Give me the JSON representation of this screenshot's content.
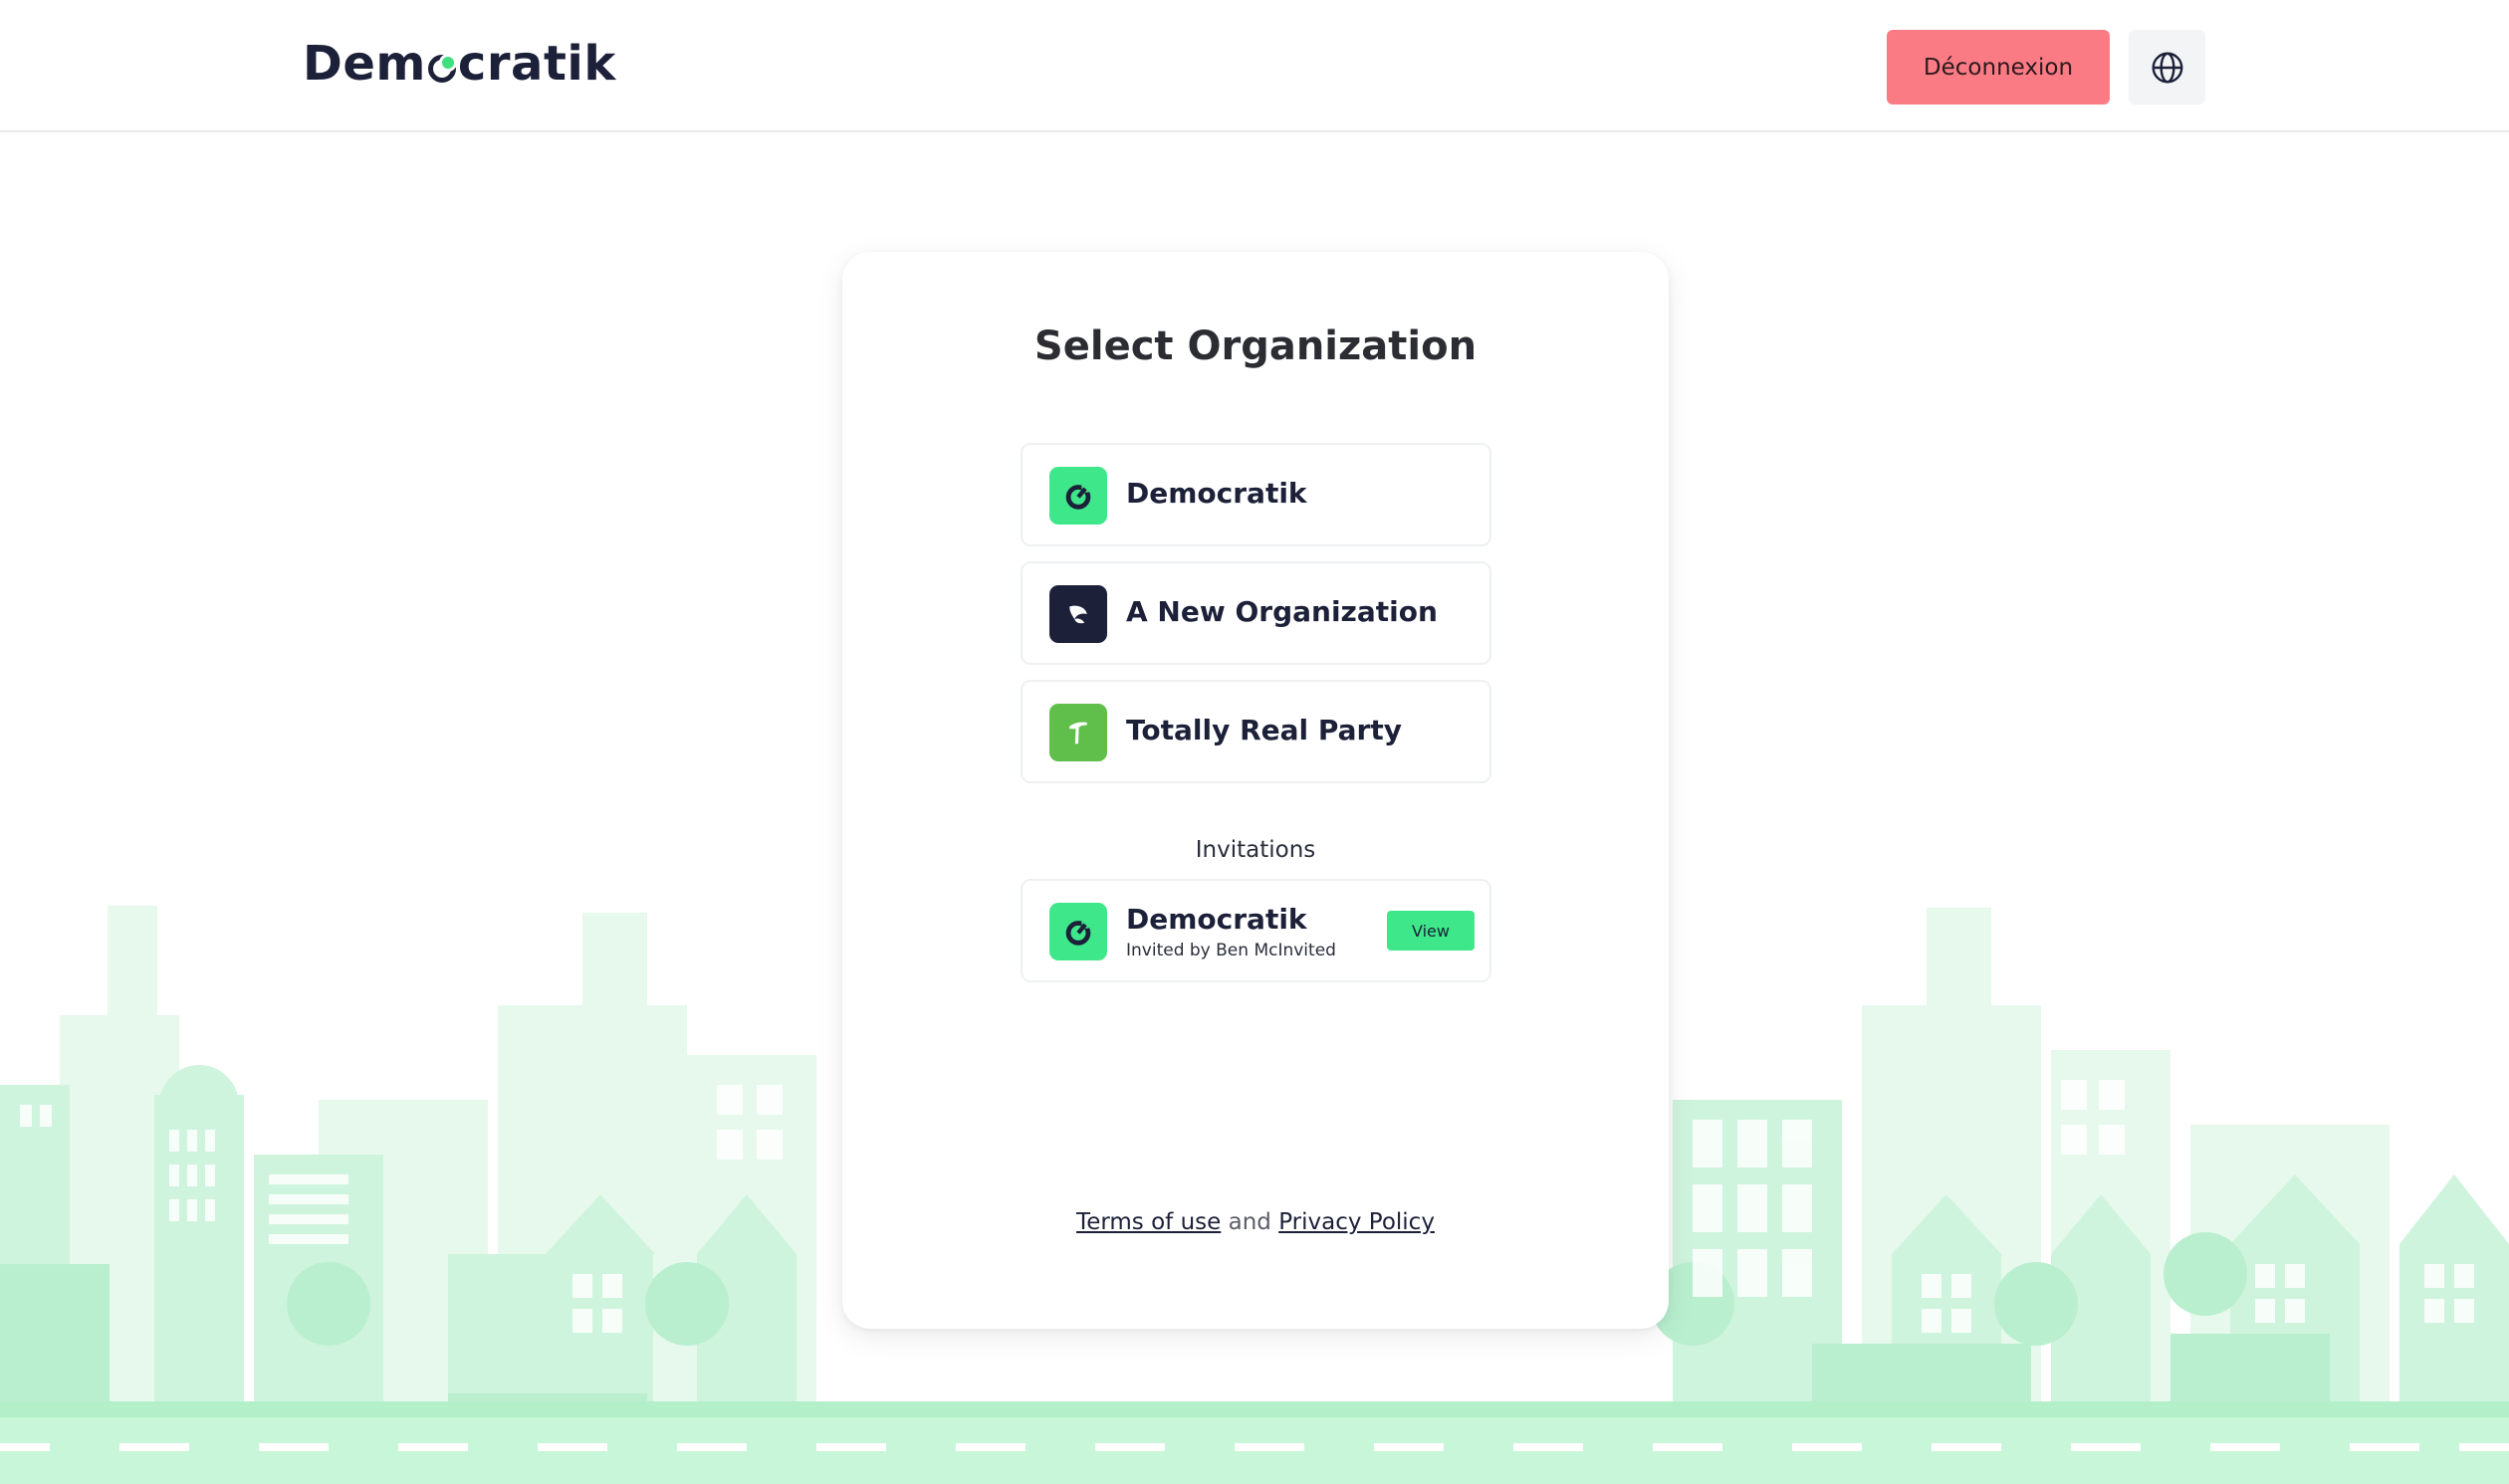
{
  "header": {
    "logo_text_before": "Dem",
    "logo_text_after": "cratik",
    "logout_label": "Déconnexion",
    "language_icon": "globe-icon"
  },
  "card": {
    "title": "Select Organization",
    "organizations": [
      {
        "name": "Democratik",
        "icon": "democratik-logo-icon",
        "color": "#3ee88a"
      },
      {
        "name": "A New Organization",
        "icon": "leaf-logo-icon",
        "color": "#1c2038"
      },
      {
        "name": "Totally Real Party",
        "icon": "flag-t-logo-icon",
        "color": "#5fbf4a"
      }
    ],
    "invitations_heading": "Invitations",
    "invitations": [
      {
        "name": "Democratik",
        "subtitle": "Invited by Ben McInvited",
        "view_label": "View",
        "icon": "democratik-logo-icon"
      }
    ],
    "legal": {
      "terms": "Terms of use",
      "and": "and",
      "privacy": "Privacy Policy"
    }
  },
  "colors": {
    "accent": "#3ee88a",
    "logout": "#fb7b84",
    "city_light": "#e4f8ea",
    "city_mid": "#bff0d2",
    "city_dark": "#9ee9bd"
  }
}
